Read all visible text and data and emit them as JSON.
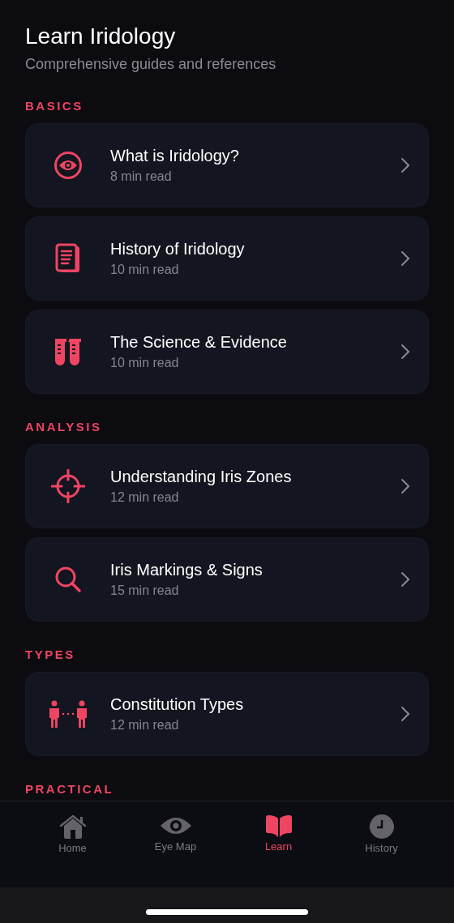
{
  "header": {
    "title": "Learn Iridology",
    "subtitle": "Comprehensive guides and references"
  },
  "sections": [
    {
      "title": "BASICS",
      "items": [
        {
          "kind": "eye",
          "title": "What is Iridology?",
          "meta": "8 min read"
        },
        {
          "kind": "document",
          "title": "History of Iridology",
          "meta": "10 min read"
        },
        {
          "kind": "tubes",
          "title": "The Science & Evidence",
          "meta": "10 min read"
        }
      ]
    },
    {
      "title": "ANALYSIS",
      "items": [
        {
          "kind": "crosshair",
          "title": "Understanding Iris Zones",
          "meta": "12 min read"
        },
        {
          "kind": "search",
          "title": "Iris Markings & Signs",
          "meta": "15 min read"
        }
      ]
    },
    {
      "title": "TYPES",
      "items": [
        {
          "kind": "people",
          "title": "Constitution Types",
          "meta": "12 min read"
        }
      ]
    },
    {
      "title": "PRACTICAL"
    }
  ],
  "tabs": [
    {
      "kind": "home",
      "label": "Home",
      "selected": false
    },
    {
      "kind": "eye",
      "label": "Eye Map",
      "selected": false
    },
    {
      "kind": "book",
      "label": "Learn",
      "selected": true
    },
    {
      "kind": "clock",
      "label": "History",
      "selected": false
    }
  ]
}
